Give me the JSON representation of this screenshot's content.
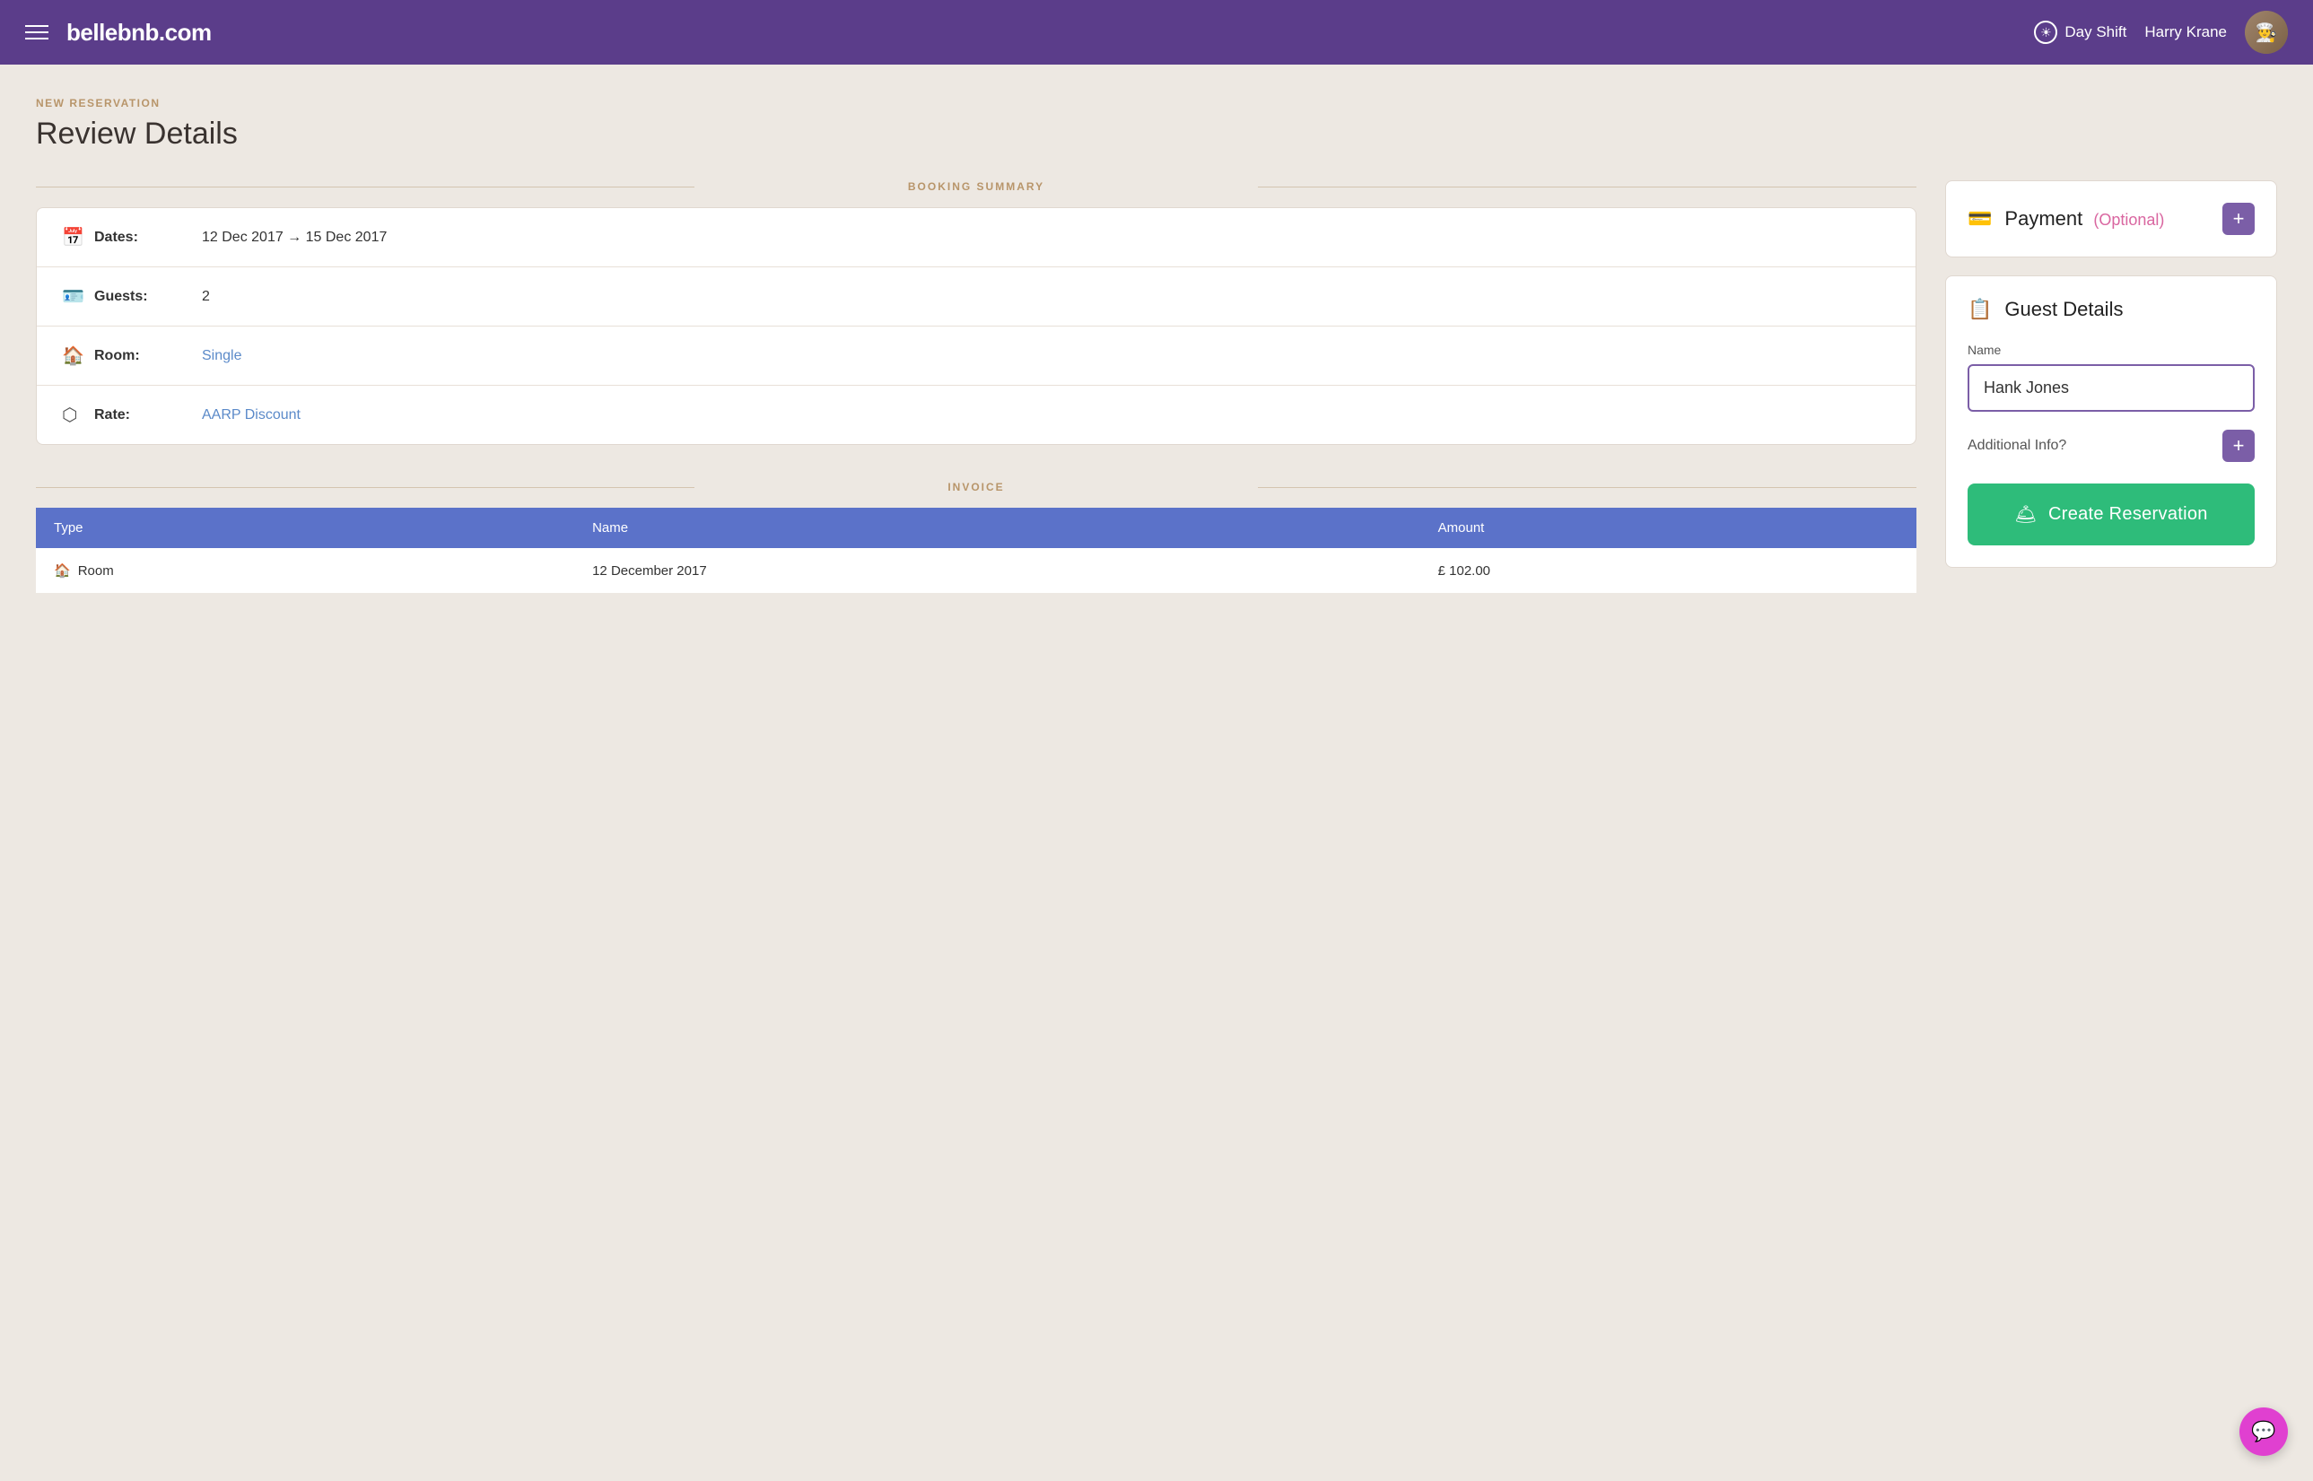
{
  "header": {
    "logo": "bellebnb.com",
    "shift": "Day Shift",
    "user_name": "Harry Krane",
    "avatar_emoji": "👨‍🍳"
  },
  "page": {
    "breadcrumb": "NEW RESERVATION",
    "title": "Review Details"
  },
  "booking_summary": {
    "section_label": "BOOKING SUMMARY",
    "dates_label": "Dates:",
    "dates_value": "12 Dec 2017 → 15 Dec 2017",
    "guests_label": "Guests:",
    "guests_value": "2",
    "room_label": "Room:",
    "room_value": "Single",
    "rate_label": "Rate:",
    "rate_value": "AARP Discount"
  },
  "invoice": {
    "section_label": "INVOICE",
    "columns": [
      "Type",
      "Name",
      "Amount"
    ],
    "rows": [
      {
        "type": "Room",
        "name": "12 December 2017",
        "amount": "£ 102.00"
      }
    ]
  },
  "payment": {
    "title": "Payment",
    "optional_label": "(Optional)",
    "plus_label": "+"
  },
  "guest_details": {
    "title": "Guest Details",
    "name_label": "Name",
    "name_value": "Hank Jones",
    "name_placeholder": "Hank Jones",
    "additional_info_label": "Additional Info?",
    "plus_label": "+"
  },
  "create_button": {
    "label": "Create Reservation",
    "icon": "🛎"
  },
  "chat": {
    "icon": "💬"
  }
}
